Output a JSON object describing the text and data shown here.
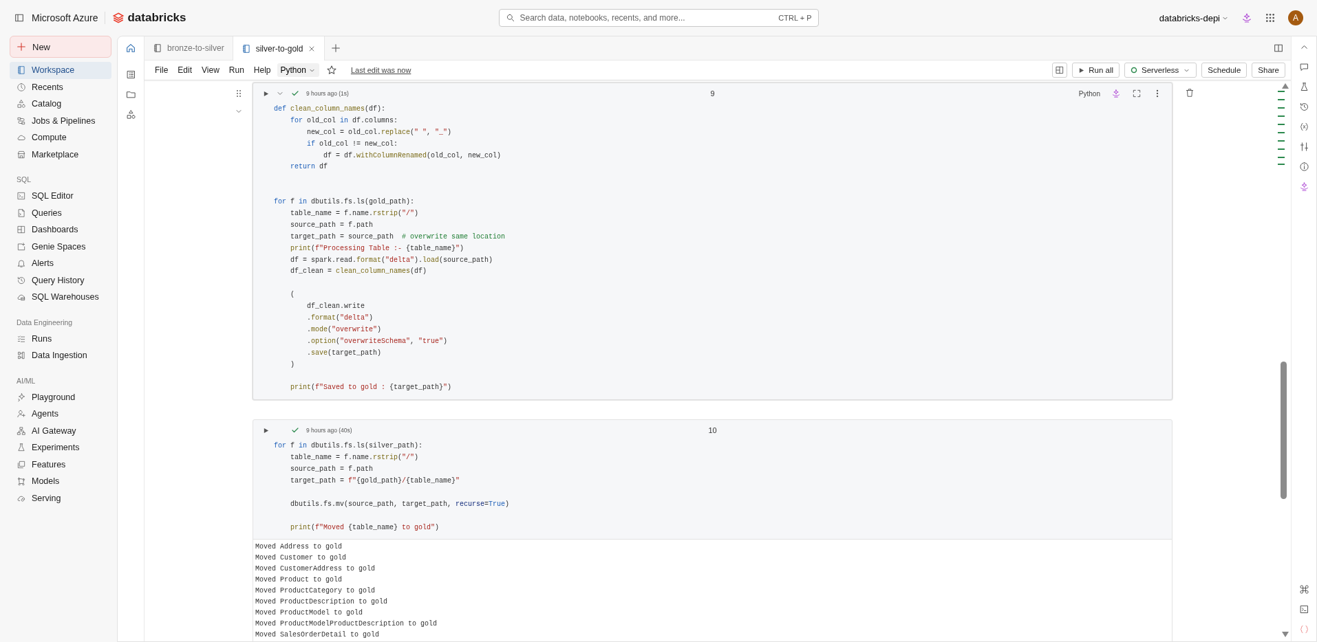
{
  "header": {
    "brand": "Microsoft Azure",
    "product": "databricks",
    "search": {
      "placeholder": "Search data, notebooks, recents, and more...",
      "shortcut": "CTRL + P"
    },
    "workspace": "databricks-depi",
    "avatar": "A"
  },
  "sidebar": {
    "new_button": "New",
    "sections": [
      {
        "items": [
          {
            "label": "Workspace",
            "selected": true
          },
          {
            "label": "Recents",
            "selected": false
          },
          {
            "label": "Catalog",
            "selected": false
          },
          {
            "label": "Jobs & Pipelines",
            "selected": false
          },
          {
            "label": "Compute",
            "selected": false
          },
          {
            "label": "Marketplace",
            "selected": false
          }
        ]
      },
      {
        "heading": "SQL",
        "items": [
          {
            "label": "SQL Editor",
            "selected": false
          },
          {
            "label": "Queries",
            "selected": false
          },
          {
            "label": "Dashboards",
            "selected": false
          },
          {
            "label": "Genie Spaces",
            "selected": false
          },
          {
            "label": "Alerts",
            "selected": false
          },
          {
            "label": "Query History",
            "selected": false
          },
          {
            "label": "SQL Warehouses",
            "selected": false
          }
        ]
      },
      {
        "heading": "Data Engineering",
        "items": [
          {
            "label": "Runs",
            "selected": false
          },
          {
            "label": "Data Ingestion",
            "selected": false
          }
        ]
      },
      {
        "heading": "AI/ML",
        "items": [
          {
            "label": "Playground",
            "selected": false
          },
          {
            "label": "Agents",
            "selected": false
          },
          {
            "label": "AI Gateway",
            "selected": false
          },
          {
            "label": "Experiments",
            "selected": false
          },
          {
            "label": "Features",
            "selected": false
          },
          {
            "label": "Models",
            "selected": false
          },
          {
            "label": "Serving",
            "selected": false
          }
        ]
      }
    ]
  },
  "tabs": [
    {
      "label": "bronze-to-silver",
      "selected": false
    },
    {
      "label": "silver-to-gold",
      "selected": true
    }
  ],
  "menu": [
    "File",
    "Edit",
    "View",
    "Run",
    "Help"
  ],
  "language": "Python",
  "last_edit": "Last edit was now",
  "toolbar": {
    "run_all": "Run all",
    "compute": "Serverless",
    "schedule": "Schedule",
    "share": "Share"
  },
  "cells": [
    {
      "focused": true,
      "status": "9 hours ago (1s)",
      "number": "9",
      "language": "Python",
      "lines": [
        {
          "kind": "code",
          "tokens": [
            {
              "kind": "kw",
              "text": "def"
            },
            {
              "kind": "fn",
              "text": " clean_column_names"
            },
            {
              "kind": "plain",
              "text": "(df):"
            }
          ]
        },
        {
          "kind": "code",
          "tokens": [
            {
              "kind": "kw",
              "text": "    for"
            },
            {
              "kind": "plain",
              "text": " old_col "
            },
            {
              "kind": "kw",
              "text": "in"
            },
            {
              "kind": "plain",
              "text": " df.columns:"
            }
          ]
        },
        {
          "kind": "code",
          "tokens": [
            {
              "kind": "plain",
              "text": "        new_col = old_col."
            },
            {
              "kind": "fn",
              "text": "replace"
            },
            {
              "kind": "plain",
              "text": "("
            },
            {
              "kind": "str",
              "text": "\" \""
            },
            {
              "kind": "plain",
              "text": ", "
            },
            {
              "kind": "str",
              "text": "\"_\""
            },
            {
              "kind": "plain",
              "text": ")"
            }
          ]
        },
        {
          "kind": "code",
          "tokens": [
            {
              "kind": "kw",
              "text": "        if"
            },
            {
              "kind": "plain",
              "text": " old_col != new_col:"
            }
          ]
        },
        {
          "kind": "code",
          "tokens": [
            {
              "kind": "plain",
              "text": "            df = df."
            },
            {
              "kind": "fn",
              "text": "withColumnRenamed"
            },
            {
              "kind": "plain",
              "text": "(old_col, new_col)"
            }
          ]
        },
        {
          "kind": "code",
          "tokens": [
            {
              "kind": "kw",
              "text": "    return"
            },
            {
              "kind": "plain",
              "text": " df"
            }
          ]
        },
        {
          "kind": "blank"
        },
        {
          "kind": "blank"
        },
        {
          "kind": "code",
          "tokens": [
            {
              "kind": "kw",
              "text": "for"
            },
            {
              "kind": "plain",
              "text": " f "
            },
            {
              "kind": "kw",
              "text": "in"
            },
            {
              "kind": "plain",
              "text": " dbutils.fs.ls(gold_path):"
            }
          ]
        },
        {
          "kind": "code",
          "tokens": [
            {
              "kind": "plain",
              "text": "    table_name = f.name."
            },
            {
              "kind": "fn",
              "text": "rstrip"
            },
            {
              "kind": "plain",
              "text": "("
            },
            {
              "kind": "str",
              "text": "\"/\""
            },
            {
              "kind": "plain",
              "text": ")"
            }
          ]
        },
        {
          "kind": "code",
          "tokens": [
            {
              "kind": "plain",
              "text": "    source_path = f.path"
            }
          ]
        },
        {
          "kind": "code",
          "tokens": [
            {
              "kind": "plain",
              "text": "    target_path = source_path  "
            },
            {
              "kind": "com",
              "text": "# overwrite same location"
            }
          ]
        },
        {
          "kind": "code",
          "tokens": [
            {
              "kind": "fn",
              "text": "    print"
            },
            {
              "kind": "plain",
              "text": "("
            },
            {
              "kind": "str",
              "text": "f\"Processing Table :- "
            },
            {
              "kind": "plain",
              "text": "{table_name}"
            },
            {
              "kind": "str",
              "text": "\""
            },
            {
              "kind": "plain",
              "text": ")"
            }
          ]
        },
        {
          "kind": "code",
          "tokens": [
            {
              "kind": "plain",
              "text": "    df = spark.read."
            },
            {
              "kind": "fn",
              "text": "format"
            },
            {
              "kind": "plain",
              "text": "("
            },
            {
              "kind": "str",
              "text": "\"delta\""
            },
            {
              "kind": "plain",
              "text": ")."
            },
            {
              "kind": "fn",
              "text": "load"
            },
            {
              "kind": "plain",
              "text": "(source_path)"
            }
          ]
        },
        {
          "kind": "code",
          "tokens": [
            {
              "kind": "plain",
              "text": "    df_clean = "
            },
            {
              "kind": "fn",
              "text": "clean_column_names"
            },
            {
              "kind": "plain",
              "text": "(df)"
            }
          ]
        },
        {
          "kind": "blank"
        },
        {
          "kind": "code",
          "tokens": [
            {
              "kind": "plain",
              "text": "    ("
            }
          ]
        },
        {
          "kind": "code",
          "tokens": [
            {
              "kind": "plain",
              "text": "        df_clean.write"
            }
          ]
        },
        {
          "kind": "code",
          "tokens": [
            {
              "kind": "plain",
              "text": "        ."
            },
            {
              "kind": "fn",
              "text": "format"
            },
            {
              "kind": "plain",
              "text": "("
            },
            {
              "kind": "str",
              "text": "\"delta\""
            },
            {
              "kind": "plain",
              "text": ")"
            }
          ]
        },
        {
          "kind": "code",
          "tokens": [
            {
              "kind": "plain",
              "text": "        ."
            },
            {
              "kind": "fn",
              "text": "mode"
            },
            {
              "kind": "plain",
              "text": "("
            },
            {
              "kind": "str",
              "text": "\"overwrite\""
            },
            {
              "kind": "plain",
              "text": ")"
            }
          ]
        },
        {
          "kind": "code",
          "tokens": [
            {
              "kind": "plain",
              "text": "        ."
            },
            {
              "kind": "fn",
              "text": "option"
            },
            {
              "kind": "plain",
              "text": "("
            },
            {
              "kind": "str",
              "text": "\"overwriteSchema\""
            },
            {
              "kind": "plain",
              "text": ", "
            },
            {
              "kind": "str",
              "text": "\"true\""
            },
            {
              "kind": "plain",
              "text": ")"
            }
          ]
        },
        {
          "kind": "code",
          "tokens": [
            {
              "kind": "plain",
              "text": "        ."
            },
            {
              "kind": "fn",
              "text": "save"
            },
            {
              "kind": "plain",
              "text": "(target_path)"
            }
          ]
        },
        {
          "kind": "code",
          "tokens": [
            {
              "kind": "plain",
              "text": "    )"
            }
          ]
        },
        {
          "kind": "blank"
        },
        {
          "kind": "code",
          "tokens": [
            {
              "kind": "fn",
              "text": "    print"
            },
            {
              "kind": "plain",
              "text": "("
            },
            {
              "kind": "str",
              "text": "f\"Saved to gold : "
            },
            {
              "kind": "plain",
              "text": "{target_path}"
            },
            {
              "kind": "str",
              "text": "\""
            },
            {
              "kind": "plain",
              "text": ")"
            }
          ]
        }
      ]
    },
    {
      "focused": false,
      "status": "9 hours ago (40s)",
      "number": "10",
      "lines": [
        {
          "kind": "code",
          "tokens": [
            {
              "kind": "kw",
              "text": "for"
            },
            {
              "kind": "plain",
              "text": " f "
            },
            {
              "kind": "kw",
              "text": "in"
            },
            {
              "kind": "plain",
              "text": " dbutils.fs.ls(silver_path):"
            }
          ]
        },
        {
          "kind": "code",
          "tokens": [
            {
              "kind": "plain",
              "text": "    table_name = f.name."
            },
            {
              "kind": "fn",
              "text": "rstrip"
            },
            {
              "kind": "plain",
              "text": "("
            },
            {
              "kind": "str",
              "text": "\"/\""
            },
            {
              "kind": "plain",
              "text": ")"
            }
          ]
        },
        {
          "kind": "code",
          "tokens": [
            {
              "kind": "plain",
              "text": "    source_path = f.path"
            }
          ]
        },
        {
          "kind": "code",
          "tokens": [
            {
              "kind": "plain",
              "text": "    target_path = "
            },
            {
              "kind": "str",
              "text": "f\""
            },
            {
              "kind": "plain",
              "text": "{gold_path}"
            },
            {
              "kind": "str",
              "text": "/"
            },
            {
              "kind": "plain",
              "text": "{table_name}"
            },
            {
              "kind": "str",
              "text": "\""
            }
          ]
        },
        {
          "kind": "blank"
        },
        {
          "kind": "code",
          "tokens": [
            {
              "kind": "plain",
              "text": "    dbutils.fs.mv(source_path, target_path, "
            },
            {
              "kind": "param",
              "text": "recurse"
            },
            {
              "kind": "plain",
              "text": "="
            },
            {
              "kind": "kw",
              "text": "True"
            },
            {
              "kind": "plain",
              "text": ")"
            }
          ]
        },
        {
          "kind": "blank"
        },
        {
          "kind": "code",
          "tokens": [
            {
              "kind": "fn",
              "text": "    print"
            },
            {
              "kind": "plain",
              "text": "("
            },
            {
              "kind": "str",
              "text": "f\"Moved "
            },
            {
              "kind": "plain",
              "text": "{table_name}"
            },
            {
              "kind": "str",
              "text": " to gold\""
            },
            {
              "kind": "plain",
              "text": ")"
            }
          ]
        }
      ],
      "output": [
        "Moved Address to gold",
        "Moved Customer to gold",
        "Moved CustomerAddress to gold",
        "Moved Product to gold",
        "Moved ProductCategory to gold",
        "Moved ProductDescription to gold",
        "Moved ProductModel to gold",
        "Moved ProductModelProductDescription to gold",
        "Moved SalesOrderDetail to gold"
      ]
    }
  ]
}
